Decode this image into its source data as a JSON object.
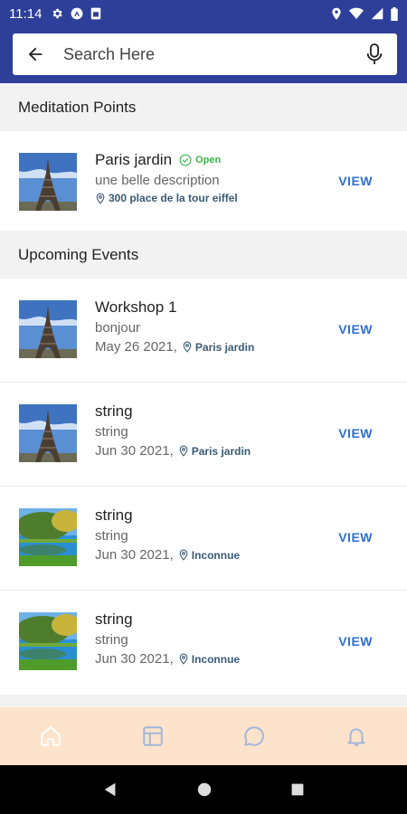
{
  "status_bar": {
    "time": "11:14"
  },
  "search": {
    "placeholder": "Search Here"
  },
  "sections": {
    "meditation": {
      "title": "Meditation Points"
    },
    "events": {
      "title": "Upcoming Events"
    }
  },
  "meditation_points": [
    {
      "title": "Paris jardin",
      "status": "Open",
      "description": "une belle description",
      "address": "300 place de la tour eiffel",
      "action": "VIEW",
      "image": "eiffel-tower"
    }
  ],
  "events": [
    {
      "title": "Workshop 1",
      "description": "bonjour",
      "date": "May 26 2021,",
      "location": "Paris jardin",
      "action": "VIEW",
      "image": "eiffel-tower"
    },
    {
      "title": "string",
      "description": "string",
      "date": "Jun 30 2021,",
      "location": "Paris jardin",
      "action": "VIEW",
      "image": "eiffel-tower"
    },
    {
      "title": "string",
      "description": "string",
      "date": "Jun 30 2021,",
      "location": "Inconnue",
      "action": "VIEW",
      "image": "garden-pond"
    },
    {
      "title": "string",
      "description": "string",
      "date": "Jun 30 2021,",
      "location": "Inconnue",
      "action": "VIEW",
      "image": "garden-pond"
    }
  ],
  "bottom_nav": [
    {
      "icon": "home-icon",
      "active": true
    },
    {
      "icon": "calendar-board-icon",
      "active": false
    },
    {
      "icon": "chat-bubble-icon",
      "active": false
    },
    {
      "icon": "bell-icon",
      "active": false
    }
  ],
  "colors": {
    "primary": "#2e3f99",
    "view_link": "#2f6fd0",
    "open_status": "#3bb54a",
    "location_text": "#3a5b73",
    "bottom_nav_bg": "#fde3cb",
    "nav_icon": "#9fb7dc"
  }
}
